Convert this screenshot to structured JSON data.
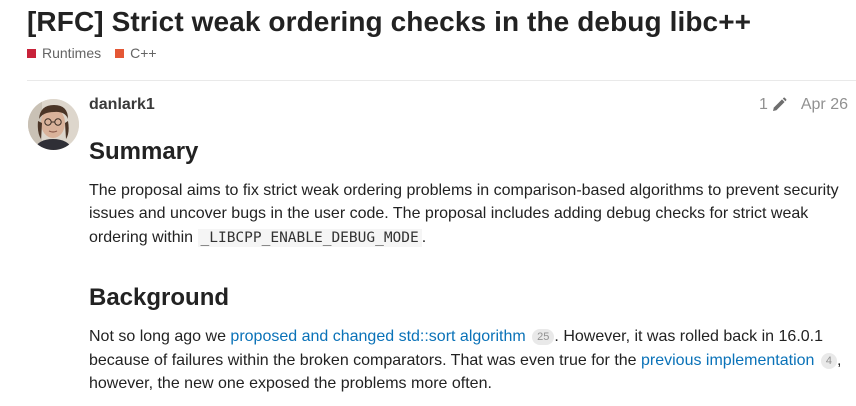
{
  "topic": {
    "title": "[RFC] Strict weak ordering checks in the debug libc++",
    "categories": [
      {
        "label": "Runtimes",
        "color": "#c8223a"
      },
      {
        "label": "C++",
        "color": "#e45735"
      }
    ]
  },
  "post": {
    "username": "danlark1",
    "edit_count": "1",
    "edit_icon": "pencil-icon",
    "date": "Apr 26",
    "summary": {
      "heading": "Summary",
      "text_1": "The proposal aims to fix strict weak ordering problems in comparison-based algorithms to prevent security issues and uncover bugs in the user code. The proposal includes adding debug checks for strict weak ordering within ",
      "code": "_LIBCPP_ENABLE_DEBUG_MODE",
      "text_2": "."
    },
    "background": {
      "heading": "Background",
      "text_1": "Not so long ago we ",
      "link_1": "proposed and changed std::sort algorithm",
      "link_1_clicks": "25",
      "text_2": ". However, it was rolled back in 16.0.1 because of failures within the broken comparators. That was even true for the ",
      "link_2": "previous implementation",
      "link_2_clicks": "4",
      "text_3": ", however, the new one exposed the problems more often."
    }
  }
}
